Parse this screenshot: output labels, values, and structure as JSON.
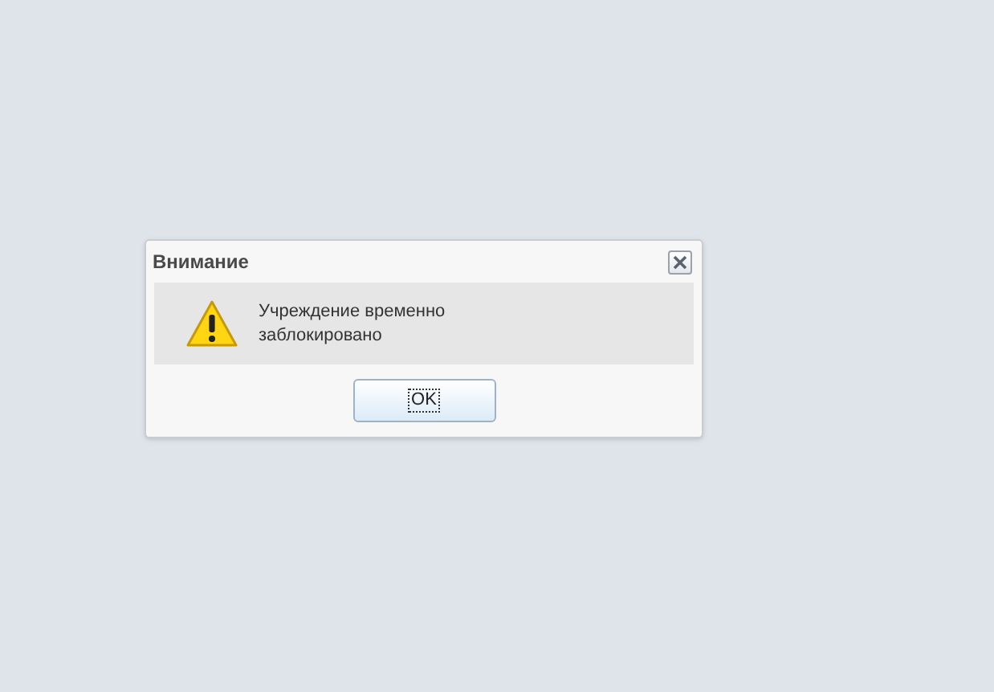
{
  "dialog": {
    "title": "Внимание",
    "message": "Учреждение временно заблокировано",
    "buttons": [
      {
        "label": "OK",
        "focused": true
      }
    ]
  }
}
